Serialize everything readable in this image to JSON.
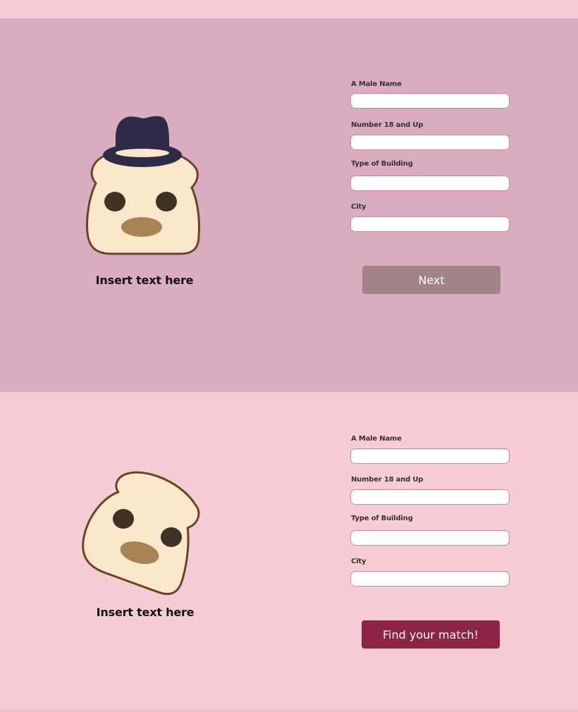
{
  "cards": [
    {
      "caption": "Insert text here",
      "fields": [
        {
          "label": "A Male Name",
          "value": "",
          "placeholder": ""
        },
        {
          "label": "Number 18 and Up",
          "value": "",
          "placeholder": ""
        },
        {
          "label": "Type of Building",
          "value": "",
          "placeholder": ""
        },
        {
          "label": "City",
          "value": "",
          "placeholder": ""
        }
      ],
      "button_label": "Next",
      "mascot": "toast-with-hat-icon"
    },
    {
      "caption": "Insert text here",
      "fields": [
        {
          "label": "A Male Name",
          "value": "",
          "placeholder": ""
        },
        {
          "label": "Number 18 and Up",
          "value": "",
          "placeholder": ""
        },
        {
          "label": "Type of Building",
          "value": "",
          "placeholder": ""
        },
        {
          "label": "City",
          "value": "",
          "placeholder": ""
        }
      ],
      "button_label": "Find your match!",
      "mascot": "toast-tilted-icon"
    }
  ],
  "colors": {
    "panel_top": "#d9adbf",
    "panel_bottom": "#f6cdd5",
    "next_button": "#a1838a",
    "match_button": "#8b2445",
    "toast_fill": "#fbe7cc",
    "toast_outline": "#6b4423",
    "hat": "#2e2b47"
  }
}
